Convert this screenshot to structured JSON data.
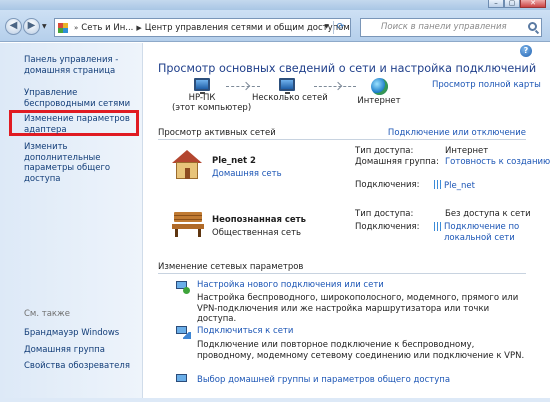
{
  "window": {
    "minimize_label": "–",
    "maximize_label": "▢",
    "close_label": "✕"
  },
  "address": {
    "breadcrumbs": [
      "Сеть и Ин...",
      "Центр управления сетями и общим доступом"
    ],
    "search_placeholder": "Поиск в панели управления"
  },
  "sidebar": {
    "home_label": "Панель управления - домашняя страница",
    "wireless_label": "Управление беспроводными сетями",
    "adapter_label": "Изменение параметров адаптера",
    "advanced_label": "Изменить дополнительные параметры общего доступа",
    "see_also_title": "См. также",
    "see_also": [
      "Брандмауэр Windows",
      "Домашняя группа",
      "Свойства обозревателя"
    ]
  },
  "main": {
    "title": "Просмотр основных сведений о сети и настройка подключений",
    "full_map_link": "Просмотр полной карты",
    "network_map": {
      "pc_name": "HP-ПК",
      "pc_sub": "(этот компьютер)",
      "middle_label": "Несколько сетей",
      "internet_label": "Интернет"
    },
    "active_networks": {
      "title": "Просмотр активных сетей",
      "connect_link": "Подключение или отключение",
      "networks": [
        {
          "name": "Ple_net  2",
          "category": "Домашняя сеть",
          "access_type_label": "Тип доступа:",
          "access_type_value": "Интернет",
          "home_group_label": "Домашняя группа:",
          "home_group_value": "Готовность к созданию",
          "connections_label": "Подключения:",
          "connections_value": "Ple_net"
        },
        {
          "name": "Неопознанная сеть",
          "category": "Общественная сеть",
          "access_type_label": "Тип доступа:",
          "access_type_value": "Без доступа к сети",
          "connections_label": "Подключения:",
          "connections_value": "Подключение по локальной сети"
        }
      ]
    },
    "change_settings": {
      "title": "Изменение сетевых параметров",
      "tasks": [
        {
          "title": "Настройка нового подключения или сети",
          "description": "Настройка беспроводного, широкополосного, модемного, прямого или VPN-подключения или же настройка маршрутизатора или точки доступа."
        },
        {
          "title": "Подключиться к сети",
          "description": "Подключение или повторное подключение к беспроводному, проводному, модемному сетевому соединению или подключение к VPN."
        },
        {
          "title": "Выбор домашней группы и параметров общего доступа"
        }
      ]
    }
  }
}
